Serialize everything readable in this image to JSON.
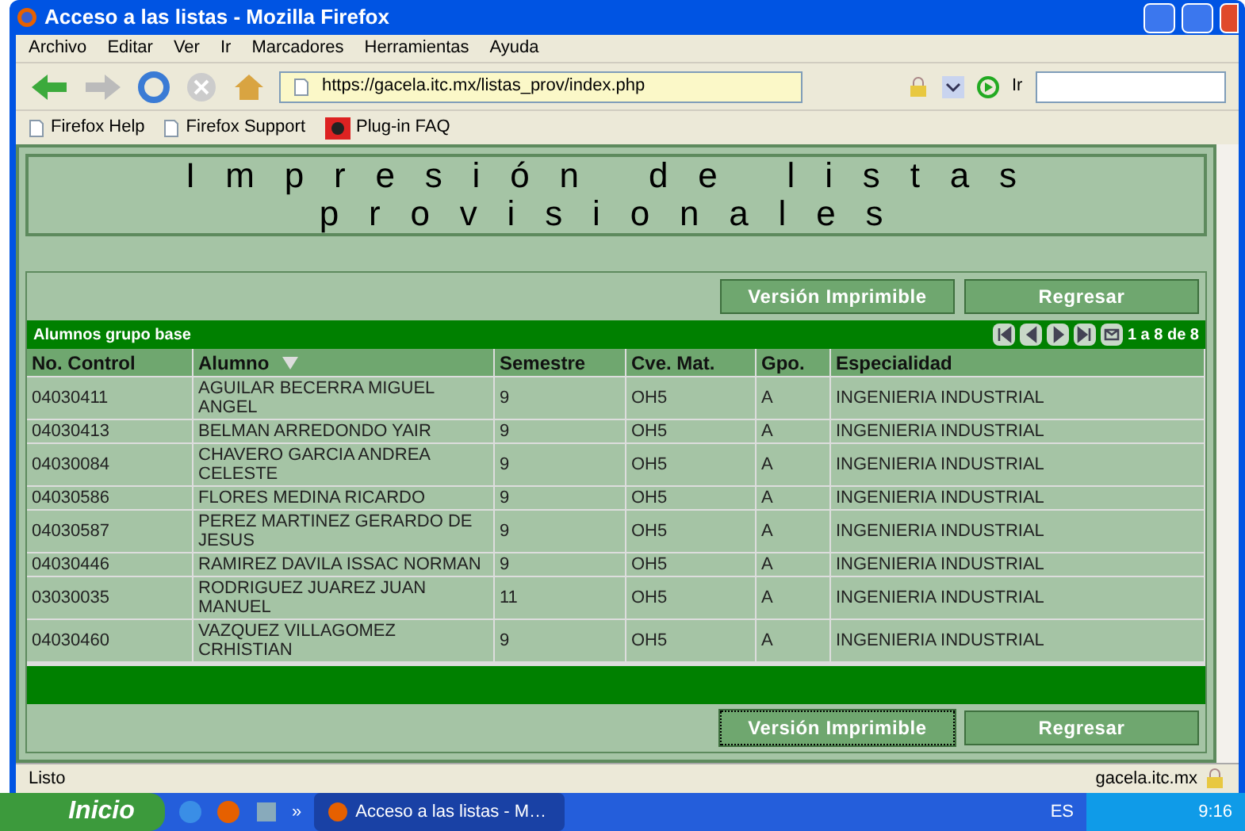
{
  "window": {
    "title": "Acceso a las listas - Mozilla Firefox"
  },
  "menu": [
    "Archivo",
    "Editar",
    "Ver",
    "Ir",
    "Marcadores",
    "Herramientas",
    "Ayuda"
  ],
  "address": {
    "value": "https://gacela.itc.mx/listas_prov/index.php"
  },
  "go_label": "Ir",
  "bookmarks": [
    {
      "label": "Firefox Help",
      "kind": "page"
    },
    {
      "label": "Firefox Support",
      "kind": "page"
    },
    {
      "label": "Plug-in FAQ",
      "kind": "plugin"
    }
  ],
  "page_title": "Impresión de listas provisionales",
  "top_buttons": [
    {
      "label": "Versión Imprimible",
      "focused": false
    },
    {
      "label": "Regresar",
      "focused": false
    }
  ],
  "grid": {
    "caption": "Alumnos grupo base",
    "pager": "1 a 8 de 8",
    "columns": [
      {
        "label": "No. Control",
        "sorted": false
      },
      {
        "label": "Alumno",
        "sorted": true
      },
      {
        "label": "Semestre",
        "sorted": false
      },
      {
        "label": "Cve. Mat.",
        "sorted": false
      },
      {
        "label": "Gpo.",
        "sorted": false
      },
      {
        "label": "Especialidad",
        "sorted": false
      }
    ],
    "rows": [
      [
        "04030411",
        "AGUILAR BECERRA MIGUEL ANGEL",
        "9",
        "OH5",
        "A",
        "INGENIERIA INDUSTRIAL"
      ],
      [
        "04030413",
        "BELMAN ARREDONDO YAIR",
        "9",
        "OH5",
        "A",
        "INGENIERIA INDUSTRIAL"
      ],
      [
        "04030084",
        "CHAVERO GARCIA ANDREA CELESTE",
        "9",
        "OH5",
        "A",
        "INGENIERIA INDUSTRIAL"
      ],
      [
        "04030586",
        "FLORES MEDINA RICARDO",
        "9",
        "OH5",
        "A",
        "INGENIERIA INDUSTRIAL"
      ],
      [
        "04030587",
        "PEREZ MARTINEZ GERARDO DE JESUS",
        "9",
        "OH5",
        "A",
        "INGENIERIA INDUSTRIAL"
      ],
      [
        "04030446",
        "RAMIREZ DAVILA ISSAC NORMAN",
        "9",
        "OH5",
        "A",
        "INGENIERIA INDUSTRIAL"
      ],
      [
        "03030035",
        "RODRIGUEZ JUAREZ JUAN MANUEL",
        "11",
        "OH5",
        "A",
        "INGENIERIA INDUSTRIAL"
      ],
      [
        "04030460",
        "VAZQUEZ VILLAGOMEZ CRHISTIAN",
        "9",
        "OH5",
        "A",
        "INGENIERIA INDUSTRIAL"
      ]
    ]
  },
  "bottom_buttons": [
    {
      "label": "Versión Imprimible",
      "focused": true
    },
    {
      "label": "Regresar",
      "focused": false
    }
  ],
  "status_bar": {
    "text": "Listo",
    "host": "gacela.itc.mx"
  },
  "taskbar": {
    "start": "Inicio",
    "chevron": "»",
    "task": "Acceso a las listas - M…",
    "language": "ES",
    "clock": "9:16"
  }
}
